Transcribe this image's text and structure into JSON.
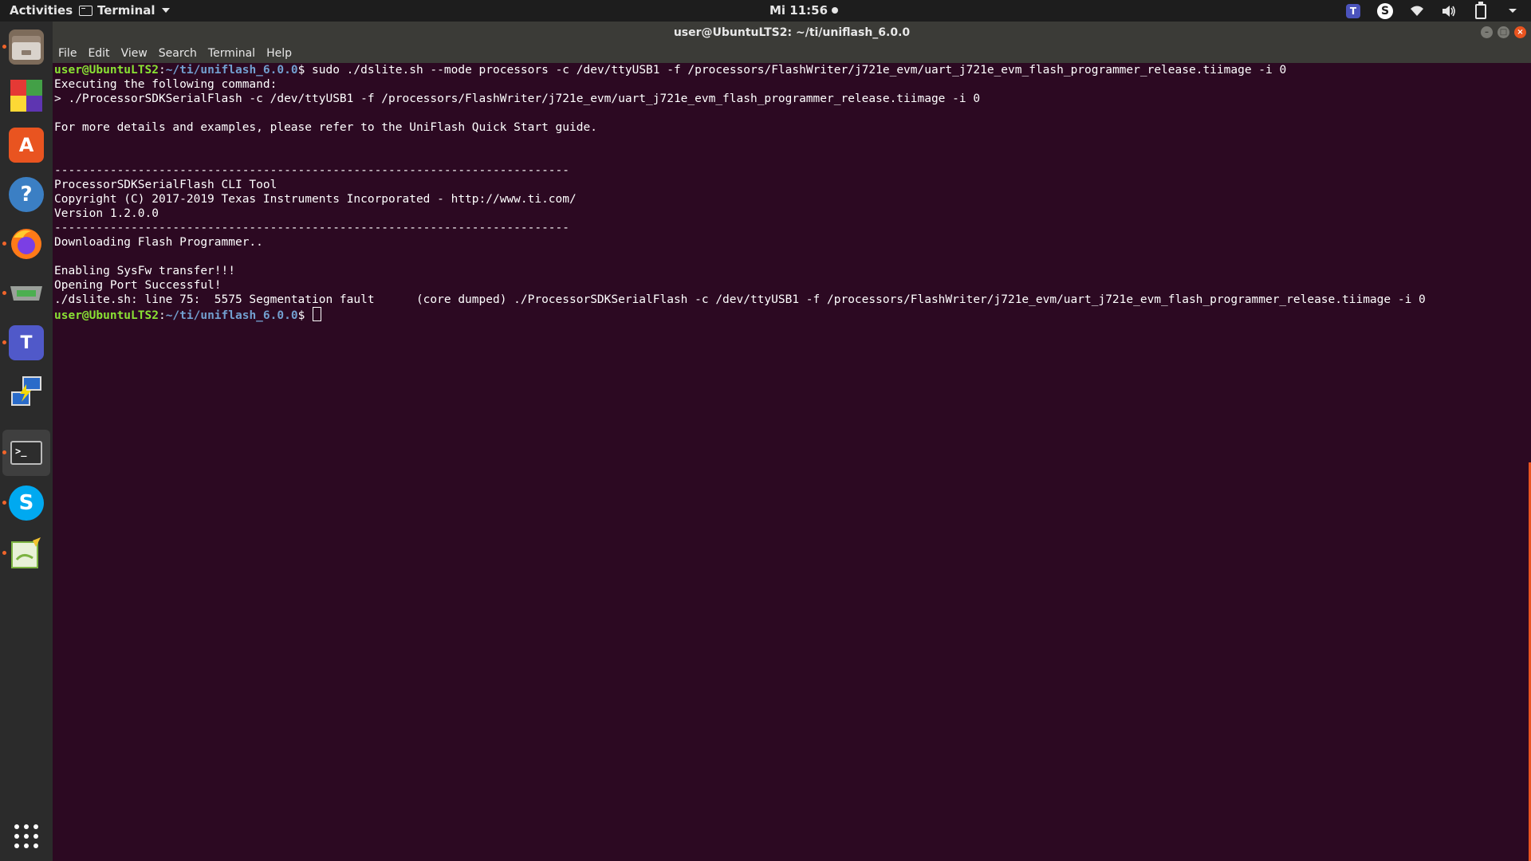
{
  "topbar": {
    "activities": "Activities",
    "app_name": "Terminal",
    "clock": "Mi 11:56",
    "tray": [
      "teams-icon",
      "skype-icon",
      "wifi-icon",
      "volume-icon",
      "battery-icon",
      "chevron-down-icon"
    ]
  },
  "dock": {
    "items": [
      "files",
      "colorful-app",
      "software-center",
      "help",
      "firefox",
      "serial-device",
      "teams",
      "remote-desktop",
      "terminal",
      "skype",
      "text-editor"
    ],
    "show_apps": "grid-icon"
  },
  "window": {
    "title": "user@UbuntuLTS2: ~/ti/uniflash_6.0.0",
    "menu": [
      "File",
      "Edit",
      "View",
      "Search",
      "Terminal",
      "Help"
    ]
  },
  "terminal": {
    "prompt_user": "user@UbuntuLTS2",
    "prompt_sep": ":",
    "prompt_path": "~/ti/uniflash_6.0.0",
    "prompt_end": "$ ",
    "command": "sudo ./dslite.sh --mode processors -c /dev/ttyUSB1 -f /processors/FlashWriter/j721e_evm/uart_j721e_evm_flash_programmer_release.tiimage -i 0",
    "output": [
      "Executing the following command:",
      "> ./ProcessorSDKSerialFlash -c /dev/ttyUSB1 -f /processors/FlashWriter/j721e_evm/uart_j721e_evm_flash_programmer_release.tiimage -i 0",
      "",
      "For more details and examples, please refer to the UniFlash Quick Start guide.",
      "",
      "",
      "--------------------------------------------------------------------------",
      "ProcessorSDKSerialFlash CLI Tool",
      "Copyright (C) 2017-2019 Texas Instruments Incorporated - http://www.ti.com/",
      "Version 1.2.0.0",
      "--------------------------------------------------------------------------",
      "Downloading Flash Programmer..",
      "",
      "Enabling SysFw transfer!!!",
      "Opening Port Successful!",
      "./dslite.sh: line 75:  5575 Segmentation fault      (core dumped) ./ProcessorSDKSerialFlash -c /dev/ttyUSB1 -f /processors/FlashWriter/j721e_evm/uart_j721e_evm_flash_programmer_release.tiimage -i 0"
    ]
  },
  "colors": {
    "terminal_bg": "#2c0922",
    "prompt_user": "#8ae234",
    "prompt_path": "#729fcf",
    "accent": "#e95420"
  }
}
